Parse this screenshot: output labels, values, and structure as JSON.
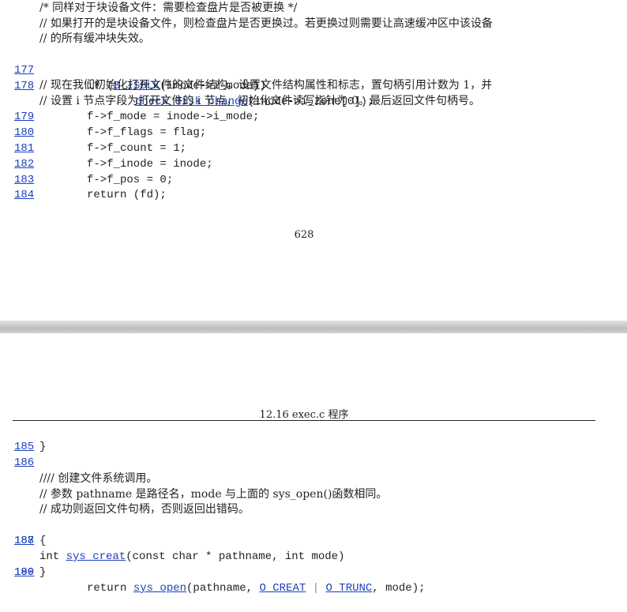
{
  "top": {
    "comments_1": [
      "/* 同样对于块设备文件：需要检查盘片是否被更换 */",
      "// 如果打开的是块设备文件，则检查盘片是否更换过。若更换过则需要让高速缓冲区中该设备",
      "// 的所有缓冲块失效。"
    ],
    "line177": {
      "num": "177",
      "pre": "if (",
      "link": "S_ISBLK",
      "post": "(inode->i_mode))"
    },
    "line178": {
      "num": "178",
      "link": "check_disk_change",
      "post": "(inode->i_zone[0]);"
    },
    "comments_2": [
      "// 现在我们初始化打开文件的文件结构。设置文件结构属性和标志，置句柄引用计数为 1，并",
      "// 设置 i 节点字段为打开文件的 i 节点，初始化文件读写指针为 0。最后返回文件句柄号。"
    ],
    "code_lines": [
      {
        "num": "179",
        "text": "f->f_mode = inode->i_mode;"
      },
      {
        "num": "180",
        "text": "f->f_flags = flag;"
      },
      {
        "num": "181",
        "text": "f->f_count = 1;"
      },
      {
        "num": "182",
        "text": "f->f_inode = inode;"
      },
      {
        "num": "183",
        "text": "f->f_pos = 0;"
      },
      {
        "num": "184",
        "text": "return (fd);"
      }
    ],
    "page_number": "628"
  },
  "bottom": {
    "header": "12.16 exec.c 程序",
    "line185": {
      "num": "185",
      "text": "}"
    },
    "line186": {
      "num": "186",
      "text": ""
    },
    "comments": [
      "//// 创建文件系统调用。",
      "// 参数 pathname 是路径名，mode 与上面的 sys_open()函数相同。",
      "// 成功则返回文件句柄，否则返回出错码。"
    ],
    "line187": {
      "num": "187",
      "pre": "int ",
      "link": "sys_creat",
      "post": "(const char * pathname, int mode)"
    },
    "line188": {
      "num": "188",
      "text": "{"
    },
    "line189": {
      "num": "189",
      "pre": "return ",
      "link1": "sys_open",
      "mid": "(pathname, ",
      "link2": "O_CREAT",
      "sep": " | ",
      "link3": "O_TRUNC",
      "post": ", mode);"
    },
    "line190": {
      "num": "190",
      "text": "}"
    }
  }
}
